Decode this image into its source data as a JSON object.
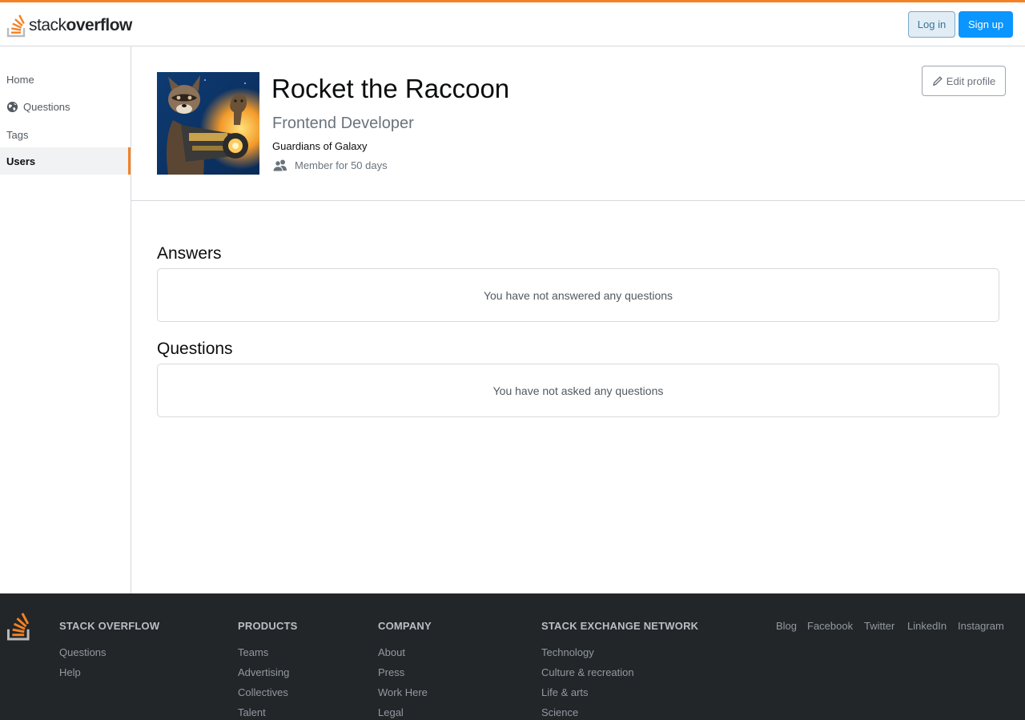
{
  "brand": {
    "word_light": "stack",
    "word_bold": "overflow",
    "accent": "#f48225"
  },
  "header": {
    "login_label": "Log in",
    "signup_label": "Sign up"
  },
  "sidebar": {
    "items": [
      {
        "label": "Home"
      },
      {
        "label": "Questions",
        "icon": "globe-icon"
      },
      {
        "label": "Tags"
      },
      {
        "label": "Users",
        "active": true
      }
    ]
  },
  "profile": {
    "name": "Rocket the Raccoon",
    "title": "Frontend Developer",
    "company": "Guardians of Galaxy",
    "member": "Member for 50 days",
    "edit_label": "Edit profile"
  },
  "answers": {
    "heading": "Answers",
    "empty": "You have not answered any questions"
  },
  "questions": {
    "heading": "Questions",
    "empty": "You have not asked any questions"
  },
  "footer": {
    "columns": [
      {
        "heading": "STACK OVERFLOW",
        "links": [
          "Questions",
          "Help"
        ]
      },
      {
        "heading": "PRODUCTS",
        "links": [
          "Teams",
          "Advertising",
          "Collectives",
          "Talent"
        ]
      },
      {
        "heading": "COMPANY",
        "links": [
          "About",
          "Press",
          "Work Here",
          "Legal"
        ]
      },
      {
        "heading": "STACK EXCHANGE NETWORK",
        "links": [
          "Technology",
          "Culture & recreation",
          "Life & arts",
          "Science"
        ]
      }
    ],
    "social": [
      "Blog",
      "Facebook",
      "Twitter",
      "LinkedIn",
      "Instagram"
    ]
  }
}
